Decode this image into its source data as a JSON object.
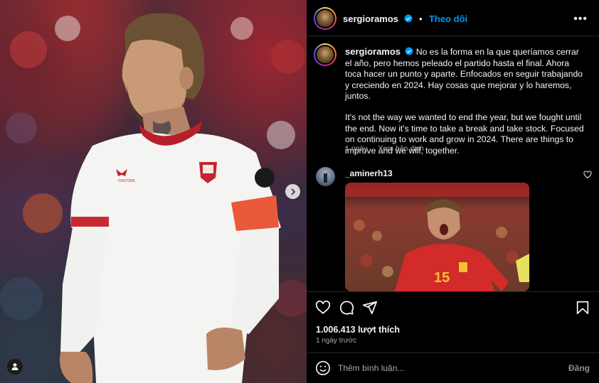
{
  "post": {
    "username": "sergioramos",
    "follow_label": "Theo dõi",
    "more_label": "•••",
    "caption_username": "sergioramos",
    "caption_es": "No es la forma en la que queríamos cerrar el año, pero hemos peleado el partido hasta el final. Ahora toca hacer un punto y aparte. Enfocados en seguir trabajando y creciendo en 2024. Hay cosas que mejorar y lo haremos, juntos.",
    "caption_en": "It's not the way we wanted to end the year, but we fought until the end. Now it's time to take a break and take stock. Focused on continuing to work and grow in 2024. There are things to improve and we will, together.",
    "caption_age": "1 ngày",
    "translate_label": "Xem bản dịch",
    "likes": "1.006.413 lượt thích",
    "posted_ago": "1 ngày trước"
  },
  "comment": {
    "username": "_aminerh13"
  },
  "comment_box": {
    "placeholder": "Thêm bình luận...",
    "post_label": "Đăng"
  },
  "media": {
    "next_icon": "chevron-right-icon",
    "tag_icon": "person-icon",
    "jersey_number_gif": "15"
  },
  "icons": {
    "like": "heart-icon",
    "comment": "comment-icon",
    "share": "share-icon",
    "save": "bookmark-icon",
    "emoji": "emoji-icon",
    "verified": "verified-badge-icon"
  },
  "colors": {
    "accent": "#0095f6",
    "background": "#000000",
    "muted_text": "#a8a8a8",
    "divider": "#262626"
  }
}
